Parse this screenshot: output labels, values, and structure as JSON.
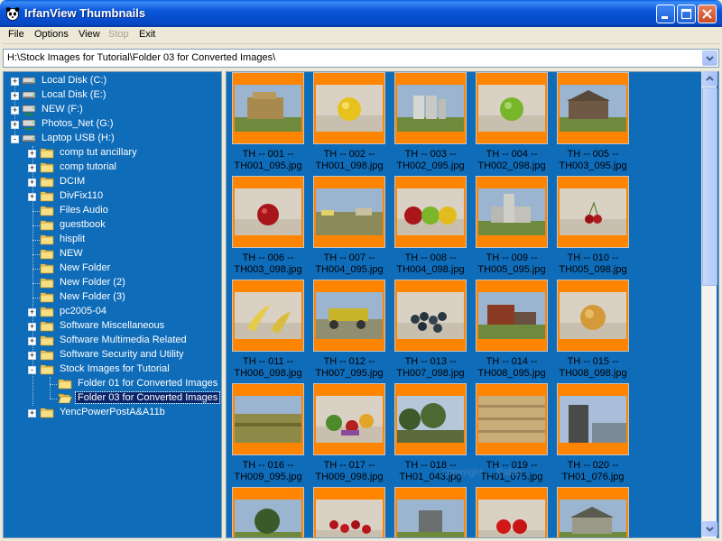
{
  "window": {
    "title": "IrfanView Thumbnails"
  },
  "menu": [
    {
      "label": "File",
      "disabled": false
    },
    {
      "label": "Options",
      "disabled": false
    },
    {
      "label": "View",
      "disabled": false
    },
    {
      "label": "Stop",
      "disabled": true
    },
    {
      "label": "Exit",
      "disabled": false
    }
  ],
  "path": {
    "value": "H:\\Stock Images for Tutorial\\Folder 03 for Converted Images\\"
  },
  "tree": [
    {
      "label": "Local Disk (C:)",
      "kind": "drive",
      "expander": "+",
      "level": 0
    },
    {
      "label": "Local Disk (E:)",
      "kind": "drive",
      "expander": "+",
      "level": 0
    },
    {
      "label": "NEW (F:)",
      "kind": "netdrive",
      "expander": "+",
      "level": 0
    },
    {
      "label": "Photos_Net (G:)",
      "kind": "netdrive",
      "expander": "+",
      "level": 0
    },
    {
      "label": "Laptop USB (H:)",
      "kind": "drive",
      "expander": "-",
      "level": 0
    },
    {
      "label": "comp tut ancillary",
      "kind": "folder",
      "expander": "+",
      "level": 1
    },
    {
      "label": "comp tutorial",
      "kind": "folder",
      "expander": "+",
      "level": 1
    },
    {
      "label": "DCIM",
      "kind": "folder",
      "expander": "+",
      "level": 1
    },
    {
      "label": "DivFix110",
      "kind": "folder",
      "expander": "+",
      "level": 1
    },
    {
      "label": "Files Audio",
      "kind": "folder",
      "expander": "",
      "level": 1
    },
    {
      "label": "guestbook",
      "kind": "folder",
      "expander": "",
      "level": 1
    },
    {
      "label": "hisplit",
      "kind": "folder",
      "expander": "",
      "level": 1
    },
    {
      "label": "NEW",
      "kind": "folder",
      "expander": "",
      "level": 1
    },
    {
      "label": "New Folder",
      "kind": "folder",
      "expander": "",
      "level": 1
    },
    {
      "label": "New Folder (2)",
      "kind": "folder",
      "expander": "",
      "level": 1
    },
    {
      "label": "New Folder (3)",
      "kind": "folder",
      "expander": "",
      "level": 1
    },
    {
      "label": "pc2005-04",
      "kind": "folder",
      "expander": "+",
      "level": 1
    },
    {
      "label": "Software Miscellaneous",
      "kind": "folder",
      "expander": "+",
      "level": 1
    },
    {
      "label": "Software Multimedia Related",
      "kind": "folder",
      "expander": "+",
      "level": 1
    },
    {
      "label": "Software Security and Utility",
      "kind": "folder",
      "expander": "+",
      "level": 1
    },
    {
      "label": "Stock Images for Tutorial",
      "kind": "folder",
      "expander": "-",
      "level": 1
    },
    {
      "label": "Folder 01 for Converted Images",
      "kind": "folder",
      "expander": "",
      "level": 2
    },
    {
      "label": "Folder 03 for Converted Images",
      "kind": "openfolder",
      "expander": "",
      "level": 2,
      "selected": true
    },
    {
      "label": "YencPowerPostA&A11b",
      "kind": "folder",
      "expander": "+",
      "level": 1
    }
  ],
  "thumbnails": [
    {
      "line1": "TH -- 001 --",
      "line2": "TH001_095.jpg",
      "subject": "hay"
    },
    {
      "line1": "TH -- 002 --",
      "line2": "TH001_098.jpg",
      "subject": "yellow-apple"
    },
    {
      "line1": "TH -- 003 --",
      "line2": "TH002_095.jpg",
      "subject": "silos"
    },
    {
      "line1": "TH -- 004 --",
      "line2": "TH002_098.jpg",
      "subject": "green-apple"
    },
    {
      "line1": "TH -- 005 --",
      "line2": "TH003_095.jpg",
      "subject": "barn"
    },
    {
      "line1": "TH -- 006 --",
      "line2": "TH003_098.jpg",
      "subject": "red-apple"
    },
    {
      "line1": "TH -- 007 --",
      "line2": "TH004_095.jpg",
      "subject": "farm-lot"
    },
    {
      "line1": "TH -- 008 --",
      "line2": "TH004_098.jpg",
      "subject": "three-apples"
    },
    {
      "line1": "TH -- 009 --",
      "line2": "TH005_095.jpg",
      "subject": "grain-elevator"
    },
    {
      "line1": "TH -- 010 --",
      "line2": "TH005_098.jpg",
      "subject": "cherries"
    },
    {
      "line1": "TH -- 011 --",
      "line2": "TH006_098.jpg",
      "subject": "bananas"
    },
    {
      "line1": "TH -- 012 --",
      "line2": "TH007_095.jpg",
      "subject": "tractor"
    },
    {
      "line1": "TH -- 013 --",
      "line2": "TH007_098.jpg",
      "subject": "berries"
    },
    {
      "line1": "TH -- 014 --",
      "line2": "TH008_095.jpg",
      "subject": "machinery"
    },
    {
      "line1": "TH -- 015 --",
      "line2": "TH008_098.jpg",
      "subject": "melon"
    },
    {
      "line1": "TH -- 016 --",
      "line2": "TH009_095.jpg",
      "subject": "field"
    },
    {
      "line1": "TH -- 017 --",
      "line2": "TH009_098.jpg",
      "subject": "vegetables"
    },
    {
      "line1": "TH -- 018 --",
      "line2": "TH01_043.jpg",
      "subject": "trees"
    },
    {
      "line1": "TH -- 019 --",
      "line2": "TH01_075.jpg",
      "subject": "wood"
    },
    {
      "line1": "TH -- 020 --",
      "line2": "TH01_076.jpg",
      "subject": "sky"
    },
    {
      "line1": "",
      "line2": "",
      "subject": "plant"
    },
    {
      "line1": "",
      "line2": "",
      "subject": "red-berries"
    },
    {
      "line1": "",
      "line2": "",
      "subject": "combine"
    },
    {
      "line1": "",
      "line2": "",
      "subject": "tomatoes"
    },
    {
      "line1": "",
      "line2": "",
      "subject": "house"
    }
  ],
  "watermark": "copyright ... Pablo",
  "colors": {
    "pane_bg": "#0f6cb9",
    "thumb_frame": "#ff8400",
    "title_bar": "#0a55d8"
  }
}
